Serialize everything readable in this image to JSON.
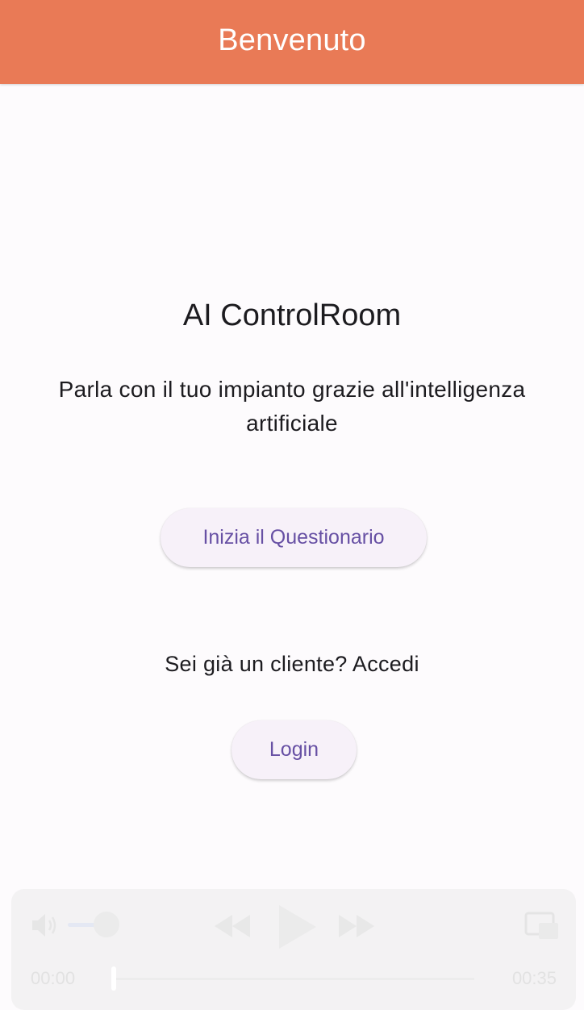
{
  "app_bar": {
    "title": "Benvenuto",
    "color": "#e97a56"
  },
  "main": {
    "title": "AI ControlRoom",
    "subtitle": "Parla con il tuo impianto grazie all'intelligenza artificiale",
    "questionnaire_button": "Inizia il Questionario",
    "client_prompt": "Sei già un cliente? Accedi",
    "login_button": "Login",
    "button_text_color": "#6750a4",
    "button_bg_color": "#f7f1f9"
  },
  "media_player": {
    "current_time": "00:00",
    "total_time": "00:35",
    "volume_level": 0.6,
    "progress": 0,
    "icons": [
      "volume-icon",
      "rewind-icon",
      "play-icon",
      "fast-forward-icon",
      "picture-in-picture-icon"
    ]
  }
}
